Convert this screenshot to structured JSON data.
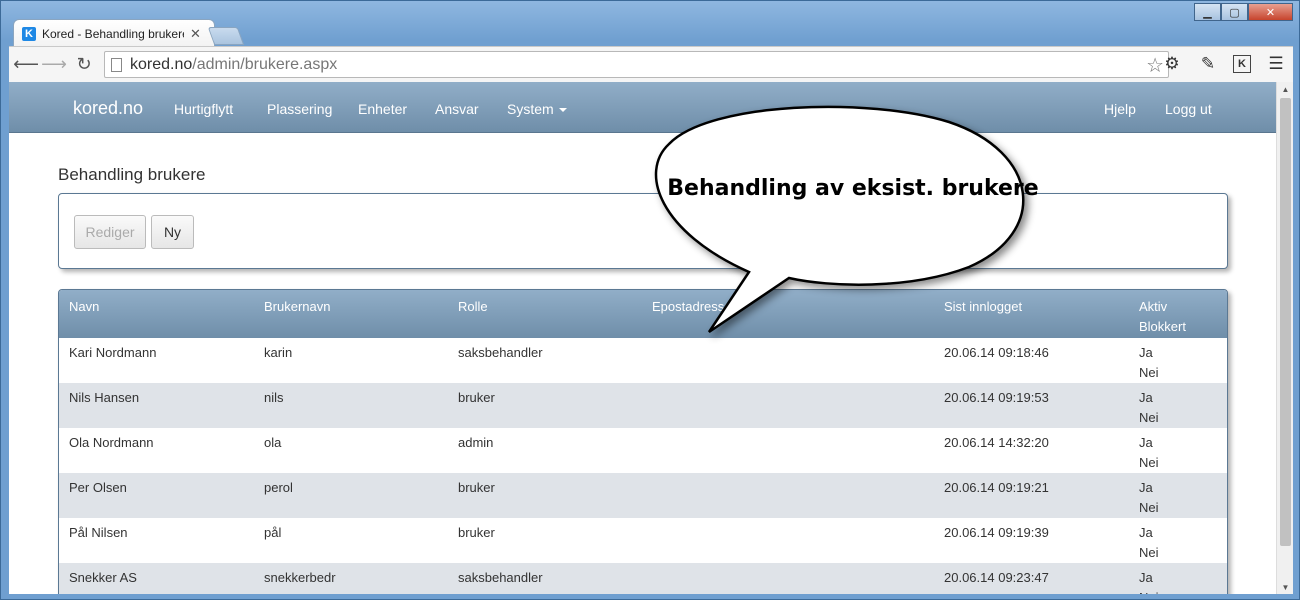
{
  "browser": {
    "tab_title": "Kored - Behandling brukere",
    "favicon_letter": "K",
    "url_host": "kored.no",
    "url_path": "/admin/brukere.aspx",
    "ext_letter": "K"
  },
  "navbar": {
    "brand": "kored.no",
    "links": [
      "Hurtigflytt",
      "Plassering",
      "Enheter",
      "Ansvar",
      "System"
    ],
    "right_links": [
      "Hjelp",
      "Logg ut"
    ]
  },
  "page": {
    "title": "Behandling brukere",
    "buttons": {
      "edit": "Rediger",
      "new": "Ny"
    }
  },
  "table": {
    "headers": [
      "Navn",
      "Brukernavn",
      "Rolle",
      "Epostadresse",
      "Sist innlogget",
      "Aktiv",
      "Blokkert"
    ],
    "rows": [
      {
        "navn": "Kari Nordmann",
        "brukernavn": "karin",
        "rolle": "saksbehandler",
        "epost": "",
        "sist": "20.06.14 09:18:46",
        "aktiv": "Ja",
        "blokkert": "Nei"
      },
      {
        "navn": "Nils Hansen",
        "brukernavn": "nils",
        "rolle": "bruker",
        "epost": "",
        "sist": "20.06.14 09:19:53",
        "aktiv": "Ja",
        "blokkert": "Nei"
      },
      {
        "navn": "Ola Nordmann",
        "brukernavn": "ola",
        "rolle": "admin",
        "epost": "",
        "sist": "20.06.14 14:32:20",
        "aktiv": "Ja",
        "blokkert": "Nei"
      },
      {
        "navn": "Per Olsen",
        "brukernavn": "perol",
        "rolle": "bruker",
        "epost": "",
        "sist": "20.06.14 09:19:21",
        "aktiv": "Ja",
        "blokkert": "Nei"
      },
      {
        "navn": "Pål Nilsen",
        "brukernavn": "pål",
        "rolle": "bruker",
        "epost": "",
        "sist": "20.06.14 09:19:39",
        "aktiv": "Ja",
        "blokkert": "Nei"
      },
      {
        "navn": "Snekker AS",
        "brukernavn": "snekkerbedr",
        "rolle": "saksbehandler",
        "epost": "",
        "sist": "20.06.14 09:23:47",
        "aktiv": "Ja",
        "blokkert": "Nei"
      }
    ]
  },
  "annotation": {
    "text": "Behandling av eksist. brukere"
  },
  "colors": {
    "navbar": "#7f9db8",
    "row_alt": "#dfe3e8",
    "panel_border": "#5b7893"
  }
}
